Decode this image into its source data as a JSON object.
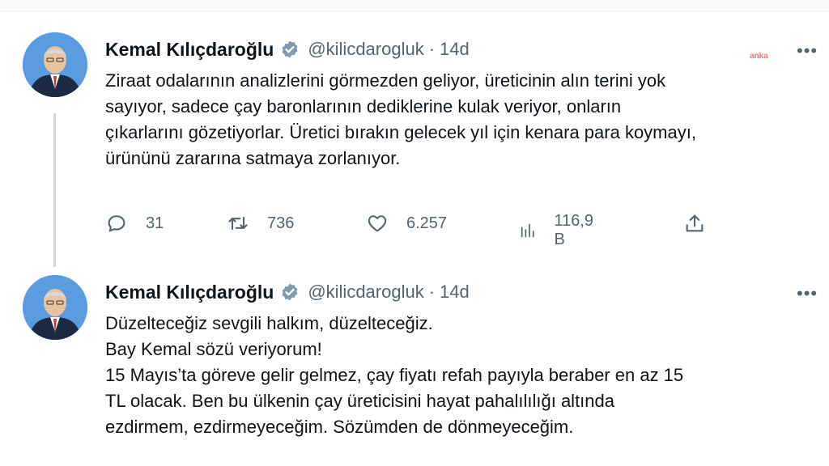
{
  "tweets": [
    {
      "author": {
        "name": "Kemal Kılıçdaroğlu",
        "handle": "@kilicdarogluk",
        "verified": true
      },
      "time": "14d",
      "lines": [
        "Ziraat odalarının analizlerini görmezden geliyor, üreticinin alın terini yok",
        "sayıyor, sadece çay baronlarının dediklerine kulak veriyor, onların",
        "çıkarlarını gözetiyorlar. Üretici bırakın gelecek yıl için kenara para koymayı,",
        "ürününü zararına satmaya zorlanıyor."
      ],
      "actions": {
        "replies": "31",
        "retweets": "736",
        "likes": "6.257",
        "views": "116,9 B"
      }
    },
    {
      "author": {
        "name": "Kemal Kılıçdaroğlu",
        "handle": "@kilicdarogluk",
        "verified": true
      },
      "time": "14d",
      "lines": [
        "Düzelteceğiz sevgili halkım, düzelteceğiz.",
        "Bay Kemal sözü veriyorum!",
        "15 Mayıs’ta göreve gelir gelmez, çay fiyatı refah payıyla beraber en az 15",
        "TL olacak. Ben bu ülkenin çay üreticisini hayat pahalılılığı altında",
        "ezdirmem, ezdirmeyeceğim. Sözümden de dönmeyeceğim."
      ]
    }
  ],
  "ui": {
    "more": "•••",
    "separator": "·",
    "watermark": "anka"
  },
  "colors": {
    "verified": "#829aab",
    "secondary": "#536471",
    "thread": "#cfd9de"
  }
}
